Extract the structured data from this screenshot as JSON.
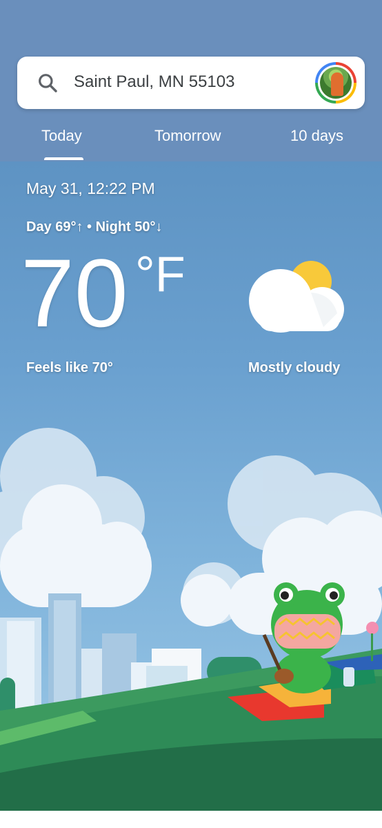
{
  "search": {
    "location": "Saint Paul, MN 55103"
  },
  "tabs": [
    {
      "label": "Today",
      "selected": true
    },
    {
      "label": "Tomorrow",
      "selected": false
    },
    {
      "label": "10 days",
      "selected": false
    }
  ],
  "current": {
    "datetime": "May 31, 12:22 PM",
    "day_night": "Day 69°↑ • Night 50°↓",
    "temperature": "70",
    "unit": "°F",
    "feels_like": "Feels like 70°",
    "condition": "Mostly cloudy",
    "condition_icon": "partly-cloudy-icon"
  },
  "colors": {
    "header": "#6a8fbc",
    "sun": "#f8c93a",
    "ground": "#2e8b57"
  }
}
